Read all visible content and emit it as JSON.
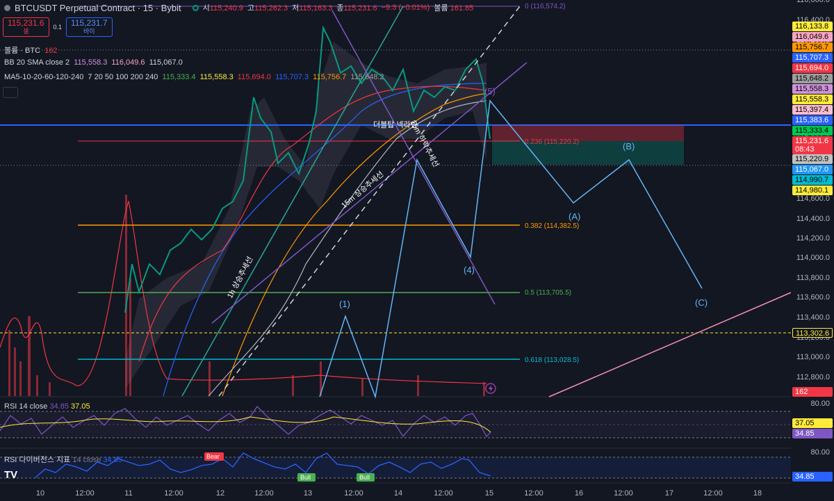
{
  "header": {
    "title": "BTCUSDT Perpetual Contract · 15 · Bybit",
    "o_label": "시",
    "o_val": "115,240.9",
    "h_label": "고",
    "h_val": "115,262.3",
    "l_label": "저",
    "l_val": "115,163.3",
    "c_label": "종",
    "c_val": "115,231.6",
    "chg": "−9.3 (−0.01%)",
    "vol_label": "볼륨",
    "vol_val": "161.85"
  },
  "trade": {
    "sell_price": "115,231.6",
    "sell_label": "셀",
    "spread": "0.1",
    "buy_price": "115,231.7",
    "buy_label": "바이"
  },
  "indicators": {
    "volume": {
      "name": "볼륨 · BTC",
      "value": "162"
    },
    "bb": {
      "name": "BB 20 SMA close 2",
      "v1": "115,558.3",
      "v2": "116,049.6",
      "v3": "115,067.0"
    },
    "ma": {
      "name": "MA5-10-20-60-120-240",
      "params": "7 20 50 100 200 240",
      "values": [
        "115,333.4",
        "115,558.3",
        "115,694.0",
        "115,707.3",
        "115,756.7",
        "115,648.2"
      ]
    }
  },
  "chart_labels": {
    "fib0": "0 (116,574.2)",
    "fib236": "0.236 (115,220.2)",
    "fib382": "0.382 (114,382.5)",
    "fib05": "0.5 (113,705.5)",
    "fib618": "0.618 (113,028.5)",
    "neckline": "더블탑 넥라인",
    "trend15m": "15m 상승추세선",
    "trend1h": "1h 상승추세선",
    "trend15m_b": "15m 하락추세선",
    "wave1": "(1)",
    "wave4": "(4)",
    "wave5": "(5)",
    "waveA": "(A)",
    "waveB": "(B)",
    "waveC": "(C)"
  },
  "price_axis": {
    "ticks": [
      "116,600.0",
      "116,400.0",
      "116,200.0",
      "116,000.0",
      "115,800.0",
      "115,600.0",
      "115,400.0",
      "115,200.0",
      "115,000.0",
      "114,800.0",
      "114,600.0",
      "114,400.0",
      "114,200.0",
      "114,000.0",
      "113,800.0",
      "113,600.0",
      "113,400.0",
      "113,200.0",
      "113,000.0",
      "112,800.0"
    ],
    "boxes": [
      {
        "label": "116,133.8",
        "bg": "#ffeb3b",
        "fg": "#000000"
      },
      {
        "label": "116,049.6",
        "bg": "#f8a5c2",
        "fg": "#000000"
      },
      {
        "label": "115,756.7",
        "bg": "#ff9800",
        "fg": "#000000"
      },
      {
        "label": "115,707.3",
        "bg": "#2962ff",
        "fg": "#ffffff"
      },
      {
        "label": "115,694.0",
        "bg": "#f23645",
        "fg": "#ffffff"
      },
      {
        "label": "115,648.2",
        "bg": "#9e9e9e",
        "fg": "#000000"
      },
      {
        "label": "115,558.3",
        "bg": "#ce93d8",
        "fg": "#000000"
      },
      {
        "label": "115,558.3",
        "bg": "#ffeb3b",
        "fg": "#000000"
      },
      {
        "label": "115,397.4",
        "bg": "#f8bbd0",
        "fg": "#000000"
      },
      {
        "label": "115,383.6",
        "bg": "#2962ff",
        "fg": "#ffffff"
      },
      {
        "label": "115,333.4",
        "bg": "#00c853",
        "fg": "#000000"
      },
      {
        "label": "115,231.6",
        "bg": "#f23645",
        "fg": "#ffffff"
      },
      {
        "label": "08:43",
        "bg": "#f23645",
        "fg": "#ffffff"
      },
      {
        "label": "115,220.9",
        "bg": "#c0c0c0",
        "fg": "#000000"
      },
      {
        "label": "115,067.0",
        "bg": "#2196f3",
        "fg": "#ffffff"
      },
      {
        "label": "114,990.7",
        "bg": "#00bcd4",
        "fg": "#000000"
      },
      {
        "label": "114,980.1",
        "bg": "#ffeb3b",
        "fg": "#000000"
      },
      {
        "label": "113,302.6",
        "bg": "#131722",
        "fg": "#ffeb3b"
      },
      {
        "label": "162",
        "bg": "#f23645",
        "fg": "#ffffff"
      }
    ]
  },
  "rsi": {
    "name": "RSI 14 close",
    "v1": "34.85",
    "v2": "37.05",
    "tick_top": "80.00",
    "box1": "37.05",
    "box2": "34.85"
  },
  "rsi_div": {
    "name": "RSI 다이버전스 지표",
    "params": "14 close",
    "value": "34.85",
    "tick_top": "80.00",
    "box": "34.85",
    "bear": "Bear",
    "bull": "Bull"
  },
  "time_axis": [
    "10",
    "12:00",
    "11",
    "12:00",
    "12",
    "12:00",
    "13",
    "12:00",
    "14",
    "12:00",
    "15",
    "12:00",
    "16",
    "12:00",
    "17",
    "12:00",
    "18"
  ],
  "logo": "TV"
}
